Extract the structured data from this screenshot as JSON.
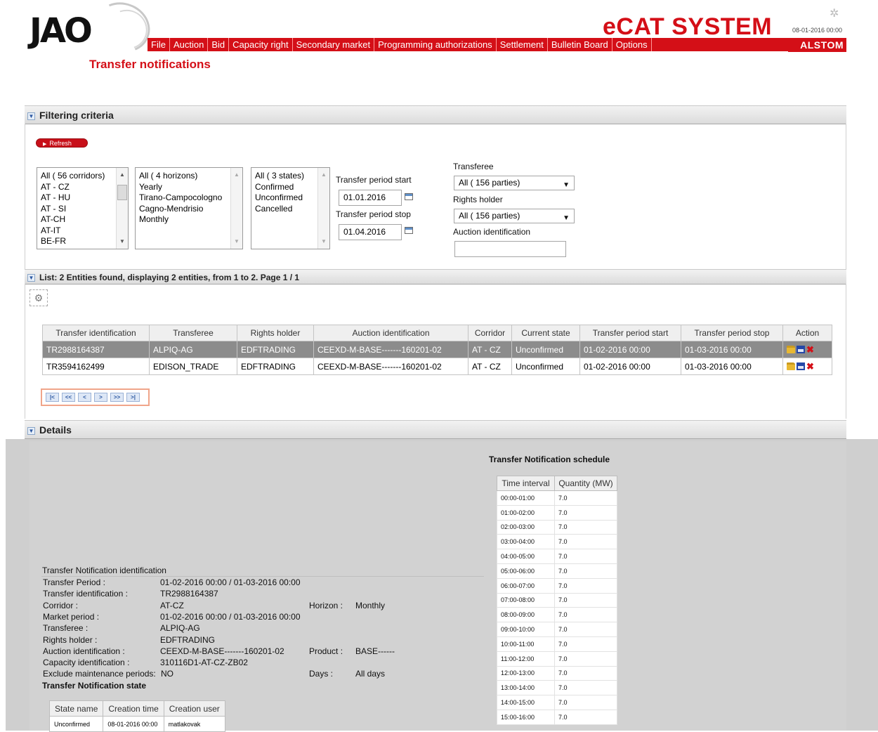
{
  "header": {
    "logo_text": "JAO",
    "menu": [
      "File",
      "Auction",
      "Bid",
      "Capacity right",
      "Secondary market",
      "Programming authorizations",
      "Settlement",
      "Bulletin Board",
      "Options"
    ],
    "app_title": "eCAT SYSTEM",
    "datetime": "08-01-2016 00:00",
    "brand": "ALSTOM"
  },
  "page_title": "Transfer notifications",
  "filter": {
    "section_title": "Filtering criteria",
    "refresh_label": "Refresh",
    "corridors": [
      "All ( 56 corridors)",
      "AT - CZ",
      "AT - HU",
      "AT - SI",
      "AT-CH",
      "AT-IT",
      "BE-FR"
    ],
    "horizons": [
      "All ( 4 horizons)",
      "Yearly",
      "Tirano-Campocologno",
      "Cagno-Mendrisio",
      "Monthly"
    ],
    "states": [
      "All ( 3 states)",
      "Confirmed",
      "Unconfirmed",
      "Cancelled"
    ],
    "period_start_label": "Transfer period start",
    "period_start_value": "01.01.2016",
    "period_stop_label": "Transfer period stop",
    "period_stop_value": "01.04.2016",
    "transferee_label": "Transferee",
    "transferee_value": "All ( 156 parties)",
    "rights_holder_label": "Rights holder",
    "rights_holder_value": "All ( 156 parties)",
    "auction_id_label": "Auction identification",
    "auction_id_value": ""
  },
  "list": {
    "section_title": "List: 2 Entities found, displaying 2 entities, from 1 to 2. Page 1 / 1",
    "columns": [
      "Transfer identification",
      "Transferee",
      "Rights holder",
      "Auction identification",
      "Corridor",
      "Current state",
      "Transfer period start",
      "Transfer period stop",
      "Action"
    ],
    "rows": [
      [
        "TR2988164387",
        "ALPIQ-AG",
        "EDFTRADING",
        "CEEXD-M-BASE-------160201-02",
        "AT - CZ",
        "Unconfirmed",
        "01-02-2016 00:00",
        "01-03-2016 00:00"
      ],
      [
        "TR3594162499",
        "EDISON_TRADE",
        "EDFTRADING",
        "CEEXD-M-BASE-------160201-02",
        "AT - CZ",
        "Unconfirmed",
        "01-02-2016 00:00",
        "01-03-2016 00:00"
      ]
    ],
    "pager": [
      "|<",
      "<<",
      "<",
      ">",
      ">>",
      ">|"
    ]
  },
  "details": {
    "section_title": "Details",
    "id_heading": "Transfer Notification identification",
    "transfer_period_label": "Transfer Period :",
    "transfer_period_value": "01-02-2016 00:00 / 01-03-2016 00:00",
    "transfer_id_label": "Transfer identification :",
    "transfer_id_value": "TR2988164387",
    "corridor_label": "Corridor :",
    "corridor_value": "AT-CZ",
    "horizon_label": "Horizon :",
    "horizon_value": "Monthly",
    "market_period_label": "Market period :",
    "market_period_value": "01-02-2016 00:00 / 01-03-2016 00:00",
    "transferee_label": "Transferee :",
    "transferee_value": "ALPIQ-AG",
    "rights_holder_label": "Rights holder :",
    "rights_holder_value": "EDFTRADING",
    "auction_id_label": "Auction identification :",
    "auction_id_value": "CEEXD-M-BASE-------160201-02",
    "product_label": "Product :",
    "product_value": "BASE------",
    "capacity_id_label": "Capacity identification :",
    "capacity_id_value": "310116D1-AT-CZ-ZB02",
    "exclude_label": "Exclude maintenance periods:",
    "exclude_value": "NO",
    "days_label": "Days :",
    "days_value": "All days",
    "state_heading": "Transfer Notification state",
    "state_columns": [
      "State name",
      "Creation time",
      "Creation user"
    ],
    "state_row": [
      "Unconfirmed",
      "08-01-2016 00:00",
      "matlakovak"
    ]
  },
  "schedule": {
    "title": "Transfer Notification schedule",
    "columns": [
      "Time interval",
      "Quantity (MW)"
    ],
    "rows": [
      [
        "00:00-01:00",
        "7.0"
      ],
      [
        "01:00-02:00",
        "7.0"
      ],
      [
        "02:00-03:00",
        "7.0"
      ],
      [
        "03:00-04:00",
        "7.0"
      ],
      [
        "04:00-05:00",
        "7.0"
      ],
      [
        "05:00-06:00",
        "7.0"
      ],
      [
        "06:00-07:00",
        "7.0"
      ],
      [
        "07:00-08:00",
        "7.0"
      ],
      [
        "08:00-09:00",
        "7.0"
      ],
      [
        "09:00-10:00",
        "7.0"
      ],
      [
        "10:00-11:00",
        "7.0"
      ],
      [
        "11:00-12:00",
        "7.0"
      ],
      [
        "12:00-13:00",
        "7.0"
      ],
      [
        "13:00-14:00",
        "7.0"
      ],
      [
        "14:00-15:00",
        "7.0"
      ],
      [
        "15:00-16:00",
        "7.0"
      ]
    ]
  }
}
